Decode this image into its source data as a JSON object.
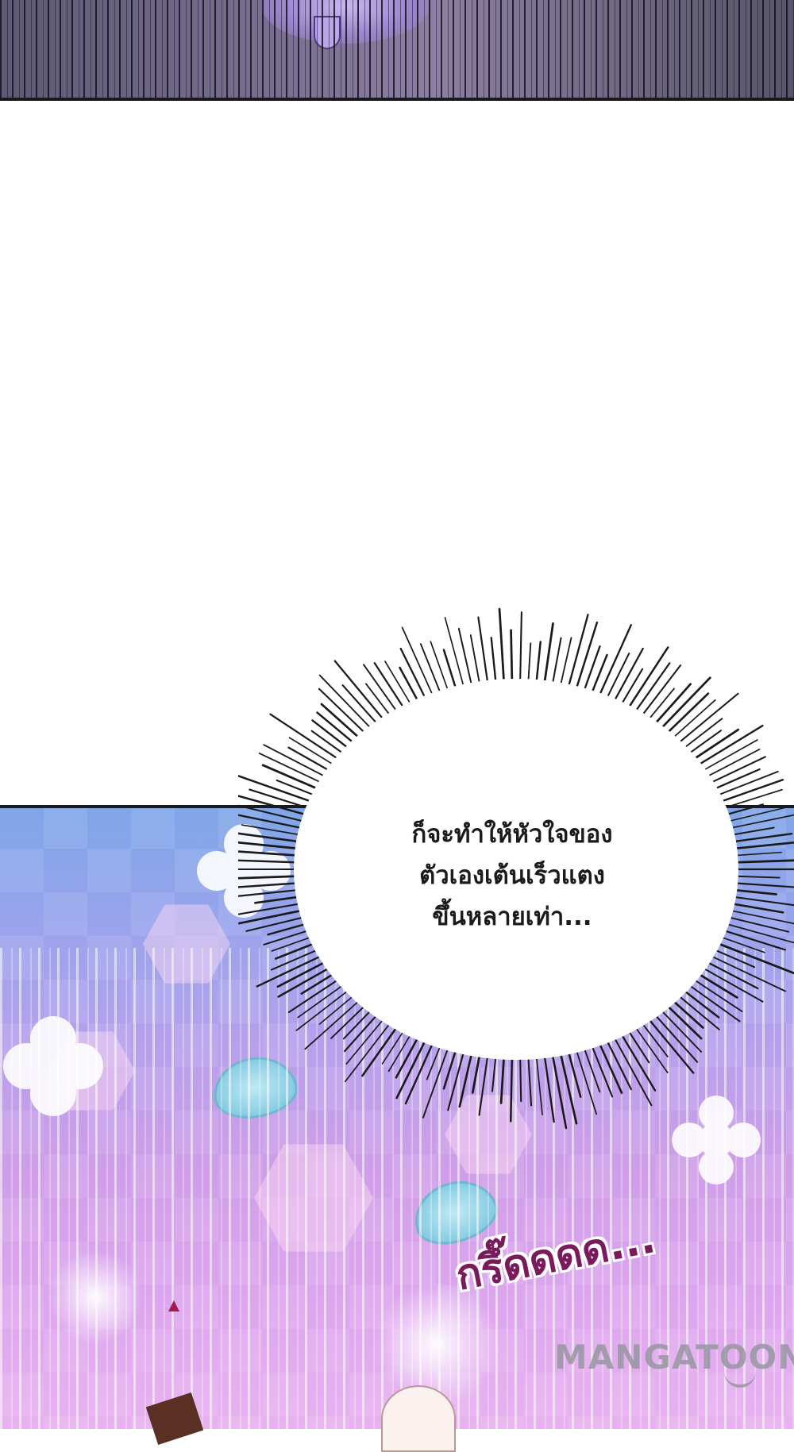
{
  "speech_bubble": {
    "lines": [
      "ก็จะทำให้หัวใจของ",
      "ตัวเองเต้นเร็วแตง",
      "ขึ้นหลายเท่า..."
    ]
  },
  "sound_effect": "กรึ๊ดดดด...",
  "watermark": "MANGATOON",
  "colors": {
    "sfx": "#7a1a5c",
    "panel_border": "#1a1a1a",
    "bubble_fill": "#ffffff"
  }
}
